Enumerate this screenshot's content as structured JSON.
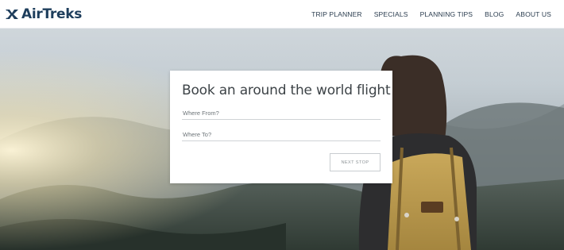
{
  "brand": {
    "name": "AirTreks",
    "icon": "airtreks-arrows-icon",
    "color": "#1e3e5c"
  },
  "nav": {
    "items": [
      {
        "label": "TRIP PLANNER"
      },
      {
        "label": "SPECIALS"
      },
      {
        "label": "PLANNING TIPS"
      },
      {
        "label": "BLOG"
      },
      {
        "label": "ABOUT US"
      }
    ]
  },
  "booking": {
    "title": "Book an around the world flight",
    "from": {
      "value": "",
      "placeholder": "Where From?"
    },
    "to": {
      "value": "",
      "placeholder": "Where To?"
    },
    "next_label": "NEXT STOP"
  }
}
